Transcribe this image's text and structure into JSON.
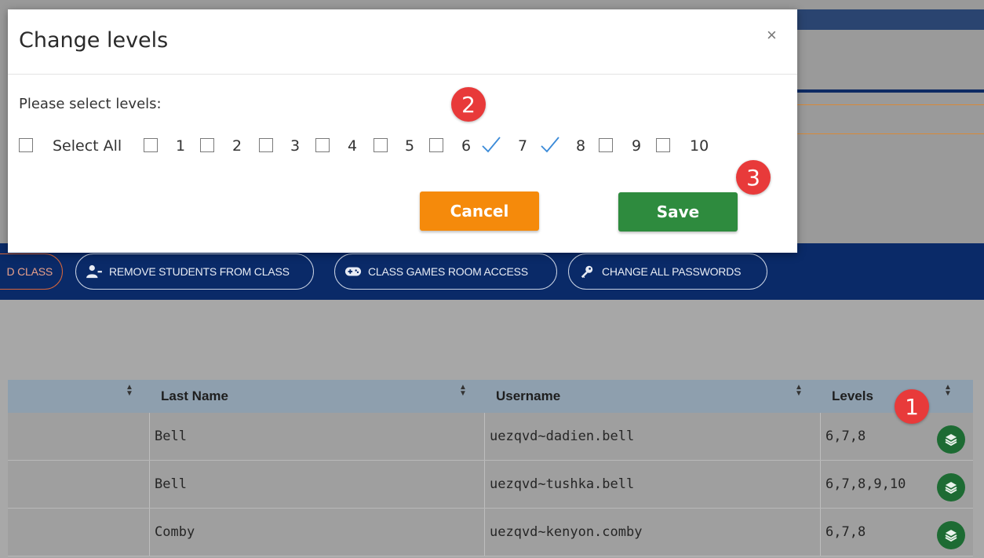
{
  "modal": {
    "title": "Change levels",
    "close_label": "×",
    "prompt": "Please select levels:",
    "select_all_label": "Select All",
    "levels": [
      {
        "label": "1",
        "checked": false
      },
      {
        "label": "2",
        "checked": false
      },
      {
        "label": "3",
        "checked": false
      },
      {
        "label": "4",
        "checked": false
      },
      {
        "label": "5",
        "checked": false
      },
      {
        "label": "6",
        "checked": false
      },
      {
        "label": "7",
        "checked": true
      },
      {
        "label": "8",
        "checked": true
      },
      {
        "label": "9",
        "checked": false
      },
      {
        "label": "10",
        "checked": false
      }
    ],
    "cancel_label": "Cancel",
    "save_label": "Save"
  },
  "toolbar": {
    "partial_label": "D CLASS",
    "remove_students_label": "REMOVE STUDENTS FROM CLASS",
    "games_room_label": "CLASS GAMES ROOM ACCESS",
    "change_passwords_label": "CHANGE ALL PASSWORDS"
  },
  "table": {
    "headers": {
      "last_name": "Last Name",
      "username": "Username",
      "levels": "Levels"
    },
    "rows": [
      {
        "last_name": "Bell",
        "username": "uezqvd~dadien.bell",
        "levels": "6,7,8"
      },
      {
        "last_name": "Bell",
        "username": "uezqvd~tushka.bell",
        "levels": "6,7,8,9,10"
      },
      {
        "last_name": "Comby",
        "username": "uezqvd~kenyon.comby",
        "levels": "6,7,8"
      }
    ]
  },
  "markers": {
    "m1": "1",
    "m2": "2",
    "m3": "3"
  },
  "colors": {
    "primary_blue": "#0a2a68",
    "cancel_orange": "#f58a0b",
    "save_green": "#2e8b3e",
    "marker_red": "#e83a3a",
    "check_blue": "#3a8ad8"
  }
}
